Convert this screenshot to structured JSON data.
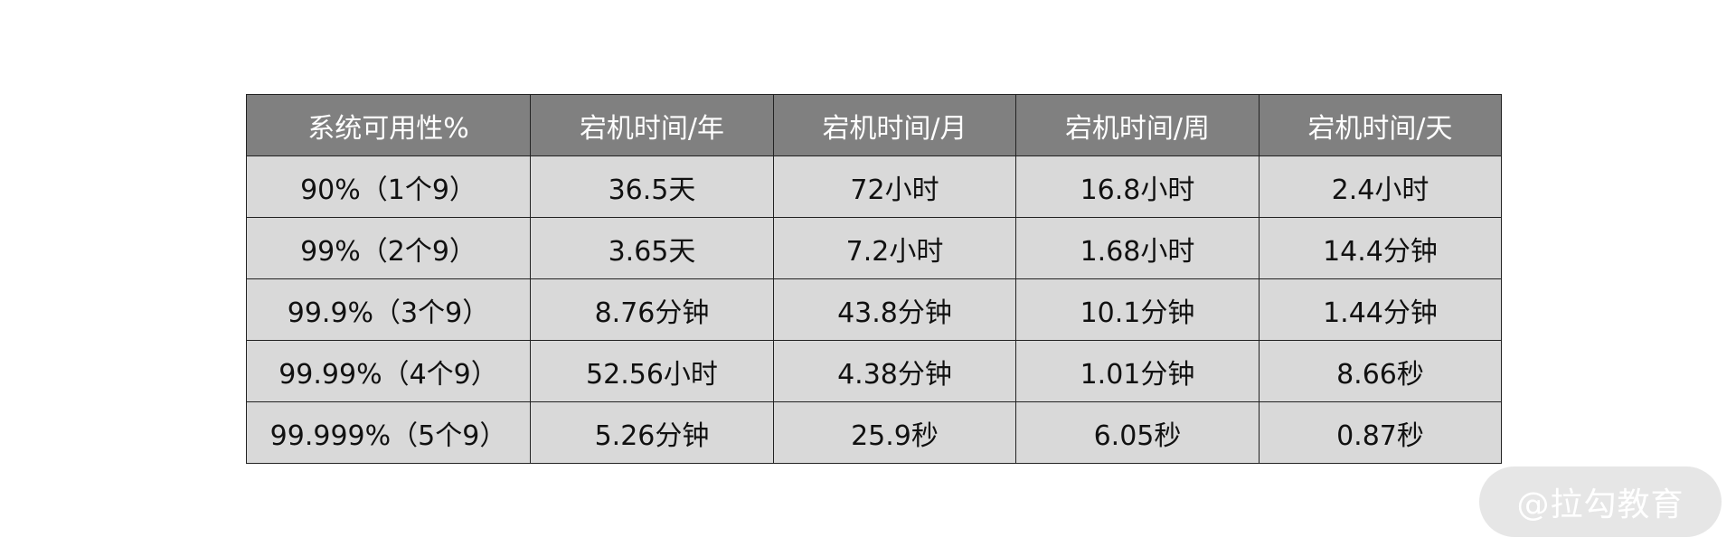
{
  "table": {
    "headers": [
      "系统可用性%",
      "宕机时间/年",
      "宕机时间/月",
      "宕机时间/周",
      "宕机时间/天"
    ],
    "rows": [
      [
        "90%（1个9）",
        "36.5天",
        "72小时",
        "16.8小时",
        "2.4小时"
      ],
      [
        "99%（2个9）",
        "3.65天",
        "7.2小时",
        "1.68小时",
        "14.4分钟"
      ],
      [
        "99.9%（3个9）",
        "8.76分钟",
        "43.8分钟",
        "10.1分钟",
        "1.44分钟"
      ],
      [
        "99.99%（4个9）",
        "52.56小时",
        "4.38分钟",
        "1.01分钟",
        "8.66秒"
      ],
      [
        "99.999%（5个9）",
        "5.26分钟",
        "25.9秒",
        "6.05秒",
        "0.87秒"
      ]
    ]
  },
  "watermark": {
    "text": "@拉勾教育"
  },
  "colors": {
    "header_bg": "#808080",
    "header_text": "#ffffff",
    "cell_bg": "#d9d9d9",
    "border": "#222222"
  }
}
